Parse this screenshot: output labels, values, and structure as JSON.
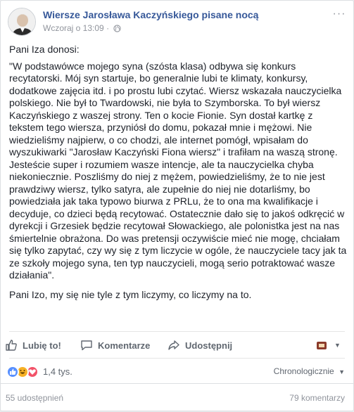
{
  "post": {
    "page_name": "Wiersze Jarosława Kaczyńskiego pisane nocą",
    "timestamp": "Wczoraj o 13:09",
    "meta_separator": "·",
    "visibility_icon": "globe-icon",
    "paragraphs": [
      "Pani Iza donosi:",
      "\"W podstawówce mojego syna (szósta klasa) odbywa się konkurs recytatorski. Mój syn startuje, bo generalnie lubi te klimaty, konkursy, dodatkowe zajęcia itd. i po prostu lubi czytać. Wiersz wskazała nauczycielka polskiego. Nie był to Twardowski, nie była to Szymborska. To był wiersz Kaczyńskiego z waszej strony. Ten o kocie Fionie. Syn dostał kartkę z tekstem tego wiersza, przyniósł do domu, pokazał mnie i mężowi. Nie wiedzieliśmy najpierw, o co chodzi, ale internet pomógł, wpisałam do wyszukiwarki \"Jarosław Kaczyński Fiona wiersz\" i trafiłam na waszą stronę. Jesteście super i rozumiem wasze intencje, ale ta nauczycielka chyba niekoniecznie. Poszliśmy do niej z mężem, powiedzieliśmy, że to nie jest prawdziwy wiersz, tylko satyra, ale zupełnie do niej nie dotarliśmy, bo powiedziała jak taka typowo biurwa z PRLu, że to ona ma kwalifikacje i decyduje, co dzieci będą recytować. Ostatecznie dało się to jakoś odkręcić w dyrekcji i Grzesiek będzie recytował Słowackiego, ale polonistka jest na nas śmiertelnie obrażona. Do was pretensji oczywiście mieć nie mogę, chciałam się tylko zapytać, czy wy się z tym liczycie w ogóle, że nauczyciele tacy jak ta ze szkoły mojego syna, ten typ nauczycieli, mogą serio potraktować wasze działania\".",
      "Pani Izo, my się nie tyle z tym liczymy, co liczymy na to."
    ]
  },
  "actions": {
    "like_label": "Lubię to!",
    "comment_label": "Komentarze",
    "share_label": "Udostępnij"
  },
  "reactions": {
    "count": "1,4 tys.",
    "types": [
      "like",
      "laugh",
      "love"
    ],
    "sort_label": "Chronologicznie",
    "colors": {
      "like": "#5890ff",
      "laugh": "#f7b125",
      "love": "#f25268"
    }
  },
  "footer": {
    "shares_label": "55 udostępnień",
    "comments_label": "79 komentarzy"
  },
  "colors": {
    "link": "#365899",
    "muted": "#90949c",
    "text": "#1d2129"
  }
}
